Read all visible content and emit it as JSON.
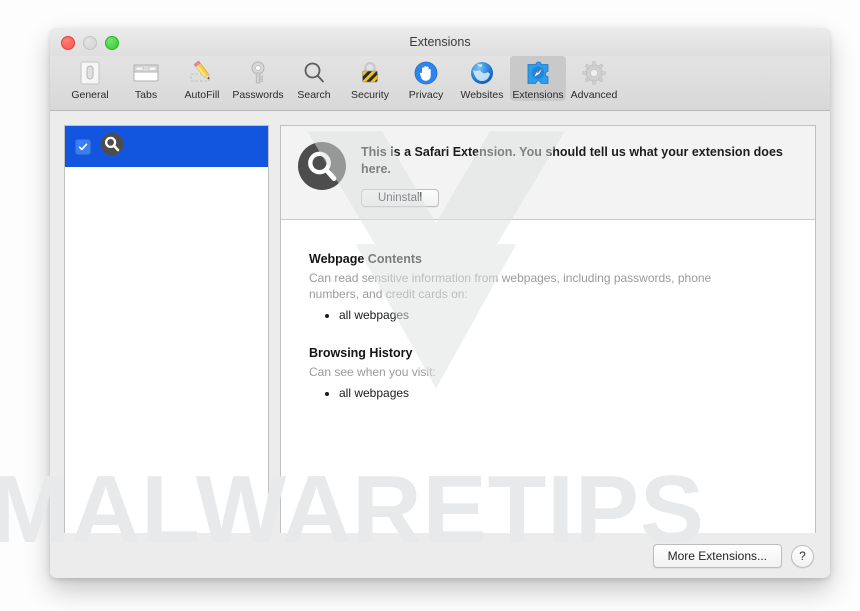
{
  "window": {
    "title": "Extensions",
    "traffic_lights": [
      {
        "name": "close-button",
        "color": "#f5564b"
      },
      {
        "name": "minimize-button",
        "color": "#d2d2d2"
      },
      {
        "name": "zoom-button",
        "color": "#2ecc2e"
      }
    ]
  },
  "toolbar": {
    "items": [
      {
        "label": "General",
        "icon": "general-icon",
        "selected": false
      },
      {
        "label": "Tabs",
        "icon": "tabs-icon",
        "selected": false
      },
      {
        "label": "AutoFill",
        "icon": "autofill-icon",
        "selected": false
      },
      {
        "label": "Passwords",
        "icon": "passwords-icon",
        "selected": false
      },
      {
        "label": "Search",
        "icon": "search-icon",
        "selected": false
      },
      {
        "label": "Security",
        "icon": "security-icon",
        "selected": false
      },
      {
        "label": "Privacy",
        "icon": "privacy-icon",
        "selected": false
      },
      {
        "label": "Websites",
        "icon": "websites-icon",
        "selected": false
      },
      {
        "label": "Extensions",
        "icon": "extensions-icon",
        "selected": true
      },
      {
        "label": "Advanced",
        "icon": "advanced-icon",
        "selected": false
      }
    ]
  },
  "extension_list": {
    "rows": [
      {
        "enabled": true,
        "icon": "magnifier-extension-icon",
        "label": "",
        "selected": true
      }
    ]
  },
  "detail": {
    "icon": "magnifier-extension-icon",
    "description": "This is a Safari Extension. You should tell us what your extension does here.",
    "uninstall_label": "Uninstall",
    "permissions": [
      {
        "title": "Webpage Contents",
        "description": "Can read sensitive information from webpages, including passwords, phone numbers, and credit cards on:",
        "items": [
          "all webpages"
        ]
      },
      {
        "title": "Browsing History",
        "description": "Can see when you visit:",
        "items": [
          "all webpages"
        ]
      }
    ]
  },
  "bottom_bar": {
    "more_extensions_label": "More Extensions...",
    "help_label": "?"
  },
  "watermark": {
    "text": "MALWARETIPS",
    "color": "#e7e9ea"
  },
  "colors": {
    "selection_blue": "#1256e0",
    "window_chrome": "#ececec",
    "toolbar_selected": "#c9c9c9"
  }
}
